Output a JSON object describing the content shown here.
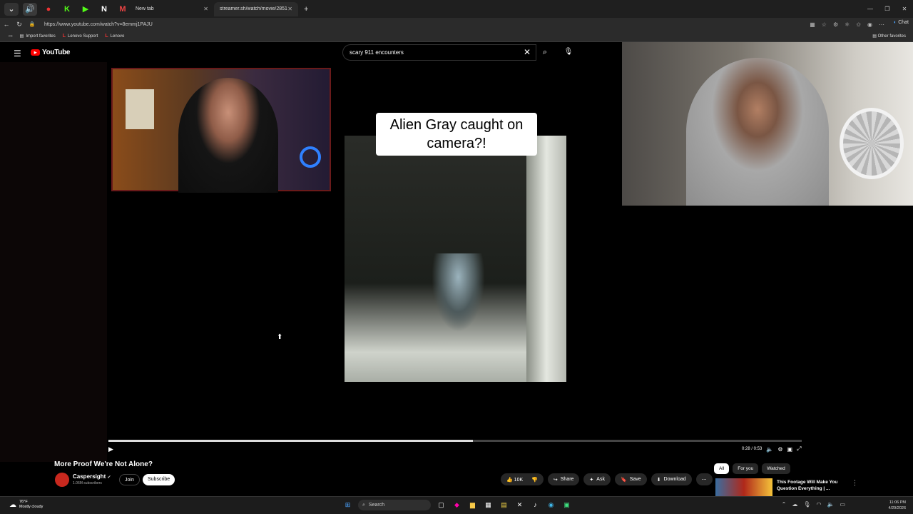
{
  "browser": {
    "tabs": [
      {
        "label": "New tab"
      },
      {
        "label": "streamer.sh/watch/movie/2851st..."
      }
    ],
    "new_tab": "+",
    "url": "https://www.youtube.com/watch?v=8emmj1PAJU",
    "chat_label": "Chat",
    "favorites": [
      {
        "label": "Import favorites"
      },
      {
        "label": "Lenovo Support"
      },
      {
        "label": "Lenovo"
      }
    ],
    "other_favorites": "Other favorites"
  },
  "youtube": {
    "logo_text": "YouTube",
    "search_value": "scary 911 encounters",
    "caption_text": "Alien Gray caught on camera?!",
    "player": {
      "progress_fraction": 0.526,
      "time": "0:28 / 0:53"
    },
    "video": {
      "title": "More Proof We're Not Alone?",
      "channel": "Caspersight",
      "subscribers": "1.06M subscribers",
      "join_label": "Join",
      "subscribe_label": "Subscribe"
    },
    "actions": {
      "likes": "10K",
      "share": "Share",
      "ask": "Ask",
      "save": "Save",
      "download": "Download"
    },
    "chips": [
      "All",
      "For you",
      "Watched"
    ],
    "recommended": {
      "title": "This Footage Will Make You Question Everything | ..."
    }
  },
  "taskbar": {
    "weather_temp": "76°F",
    "weather_desc": "Mostly cloudy",
    "search_label": "Search",
    "time": "11:06 PM",
    "date": "4/29/2026"
  },
  "colors": {
    "youtube_red": "#ff0000",
    "page_bg": "#000000"
  }
}
